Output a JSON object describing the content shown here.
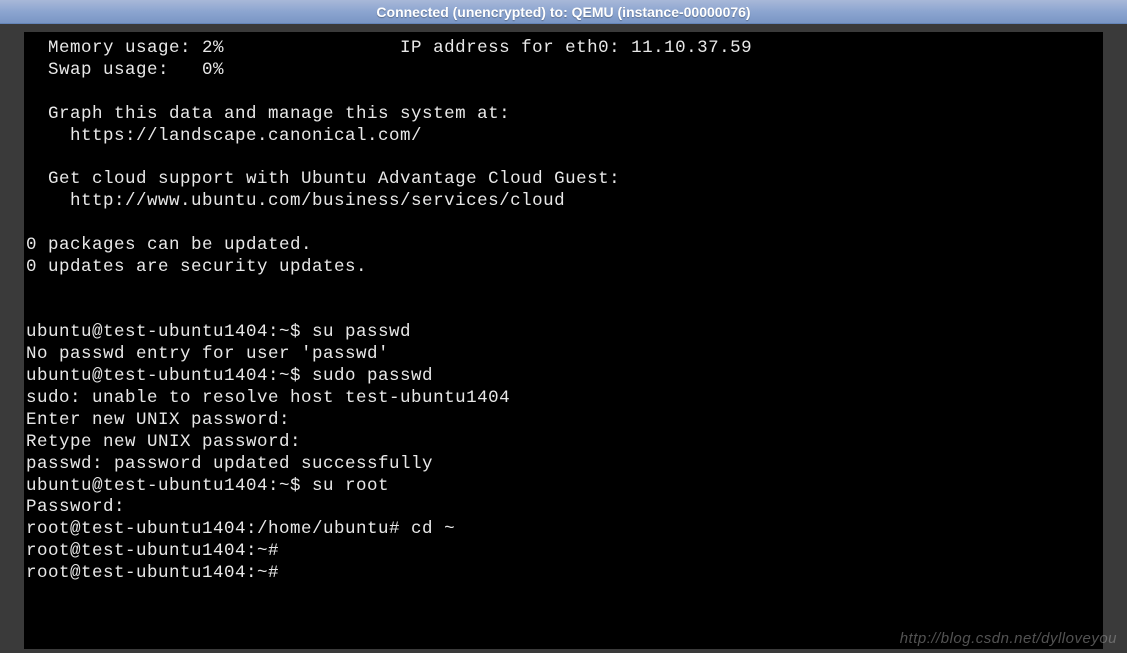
{
  "titlebar": {
    "text": "Connected (unencrypted) to: QEMU (instance-00000076)"
  },
  "terminal": {
    "lines": [
      "  Memory usage: 2%                IP address for eth0: 11.10.37.59",
      "  Swap usage:   0%",
      "",
      "  Graph this data and manage this system at:",
      "    https://landscape.canonical.com/",
      "",
      "  Get cloud support with Ubuntu Advantage Cloud Guest:",
      "    http://www.ubuntu.com/business/services/cloud",
      "",
      "0 packages can be updated.",
      "0 updates are security updates.",
      "",
      "",
      "ubuntu@test-ubuntu1404:~$ su passwd",
      "No passwd entry for user 'passwd'",
      "ubuntu@test-ubuntu1404:~$ sudo passwd",
      "sudo: unable to resolve host test-ubuntu1404",
      "Enter new UNIX password:",
      "Retype new UNIX password:",
      "passwd: password updated successfully",
      "ubuntu@test-ubuntu1404:~$ su root",
      "Password:",
      "root@test-ubuntu1404:/home/ubuntu# cd ~",
      "root@test-ubuntu1404:~#",
      "root@test-ubuntu1404:~#"
    ]
  },
  "watermark": {
    "text": "http://blog.csdn.net/dylloveyou"
  }
}
